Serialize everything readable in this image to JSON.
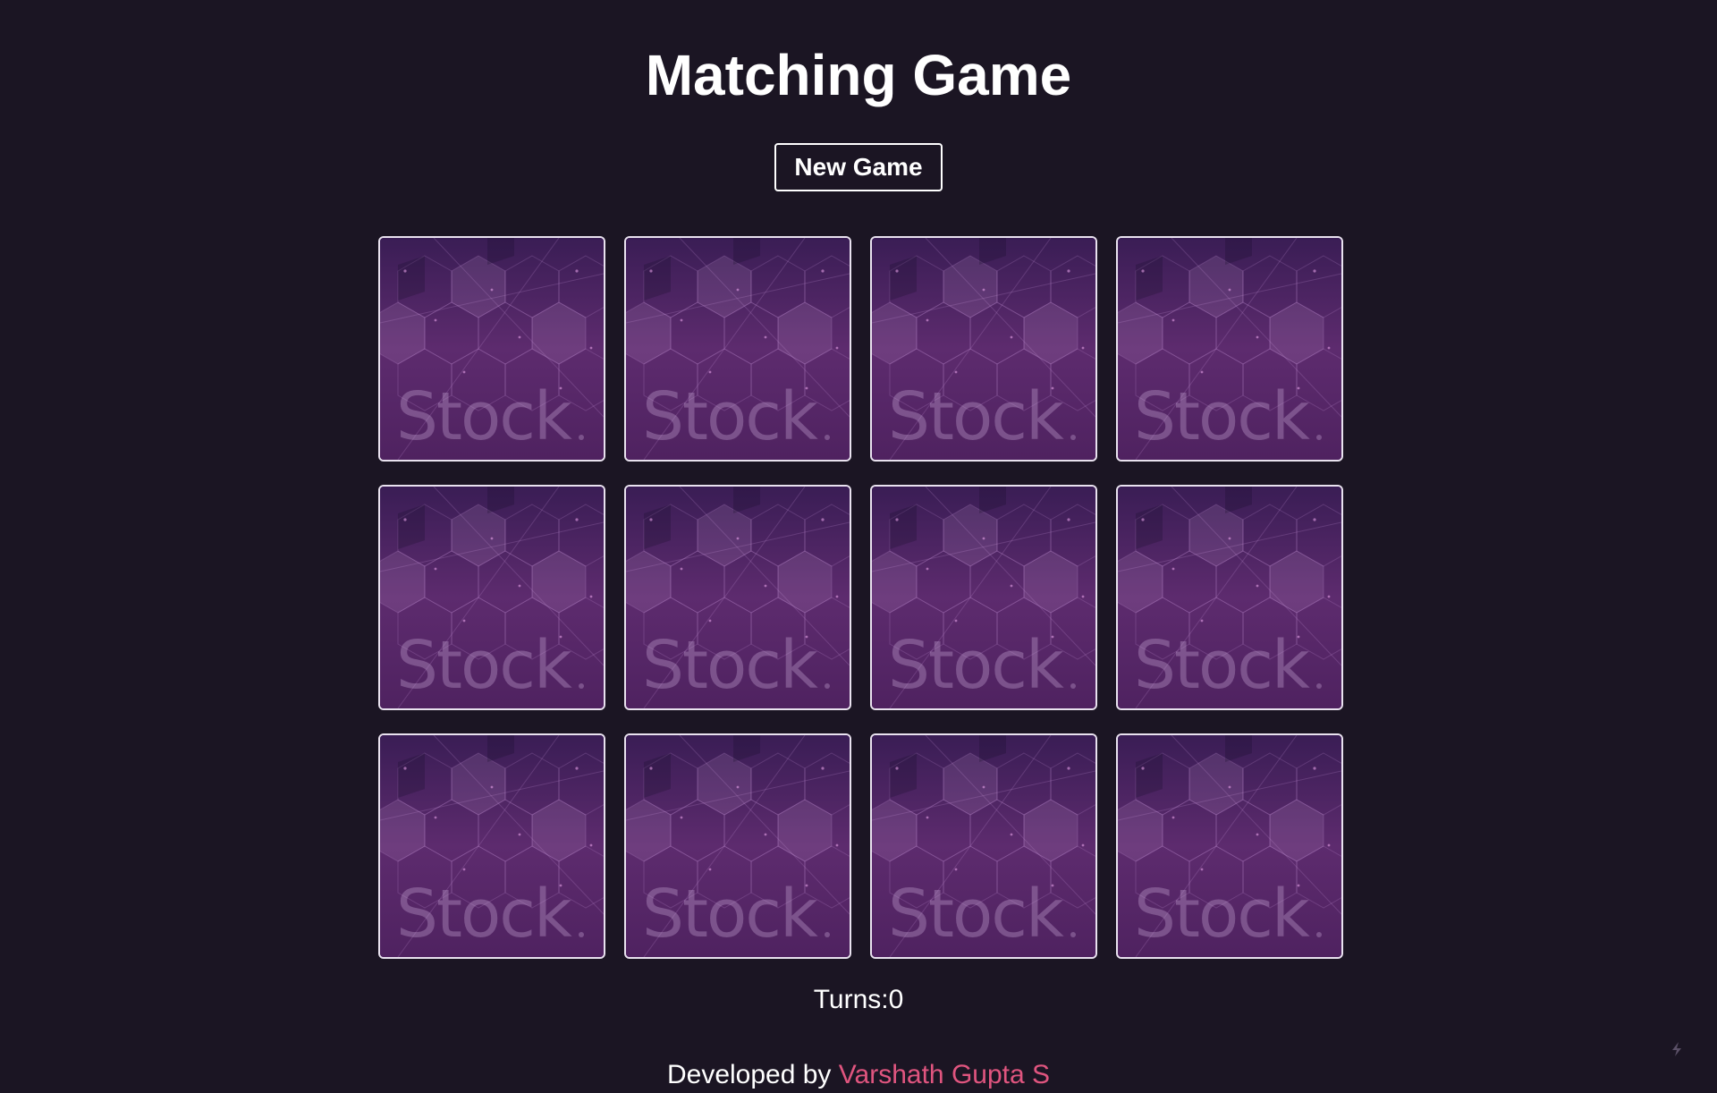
{
  "header": {
    "title": "Matching Game"
  },
  "controls": {
    "new_game_label": "New Game"
  },
  "board": {
    "card_back_text": "Stock",
    "cards": [
      {
        "state": "face-down"
      },
      {
        "state": "face-down"
      },
      {
        "state": "face-down"
      },
      {
        "state": "face-down"
      },
      {
        "state": "face-down"
      },
      {
        "state": "face-down"
      },
      {
        "state": "face-down"
      },
      {
        "state": "face-down"
      },
      {
        "state": "face-down"
      },
      {
        "state": "face-down"
      },
      {
        "state": "face-down"
      },
      {
        "state": "face-down"
      }
    ]
  },
  "status": {
    "turns_label": "Turns:",
    "turns_value": "0"
  },
  "footer": {
    "prefix": "Developed by ",
    "author": "Varshath Gupta S"
  },
  "colors": {
    "background": "#1b1523",
    "accent": "#e0557f",
    "card_back": "#5a2a6c"
  },
  "icons": {
    "corner": "lightning-icon"
  }
}
